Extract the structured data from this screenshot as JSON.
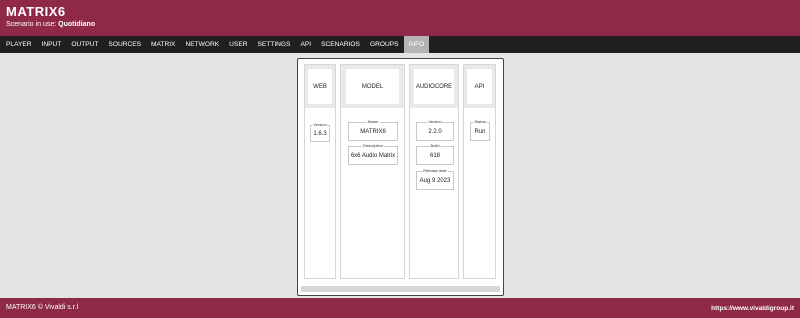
{
  "header": {
    "title": "MATRIX6",
    "scenario_label": "Scenario in use:",
    "scenario_value": "Quotidiano"
  },
  "nav": {
    "tabs": [
      {
        "label": "PLAYER"
      },
      {
        "label": "INPUT"
      },
      {
        "label": "OUTPUT"
      },
      {
        "label": "SOURCES"
      },
      {
        "label": "MATRIX"
      },
      {
        "label": "NETWORK"
      },
      {
        "label": "USER"
      },
      {
        "label": "SETTINGS"
      },
      {
        "label": "API"
      },
      {
        "label": "SCENARIOS"
      },
      {
        "label": "GROUPS"
      },
      {
        "label": "INFO"
      }
    ],
    "active_tab": "INFO"
  },
  "info": {
    "web": {
      "heading": "WEB",
      "version_label": "Version",
      "version": "1.6.3"
    },
    "model": {
      "heading": "MODEL",
      "name_label": "Name",
      "name": "MATRIX6",
      "description_label": "Description",
      "description": "6x6 Audio Matrix"
    },
    "audiocore": {
      "heading": "AUDIOCORE",
      "version_label": "Version",
      "version": "2.2.0",
      "build_label": "Build",
      "build": "618",
      "release_label": "Release date",
      "release_date": "Aug 9 2023"
    },
    "api": {
      "heading": "API",
      "status_label": "Status",
      "status": "Run"
    }
  },
  "footer": {
    "copyright": "MATRIX6 © Vivaldi s.r.l",
    "website": "https://www.vivaldigroup.it"
  },
  "colors": {
    "brand": "#8e2a47",
    "nav_bg": "#1f1f1f",
    "active_tab": "#b4b4b4",
    "page_bg": "#e4e4e4"
  }
}
